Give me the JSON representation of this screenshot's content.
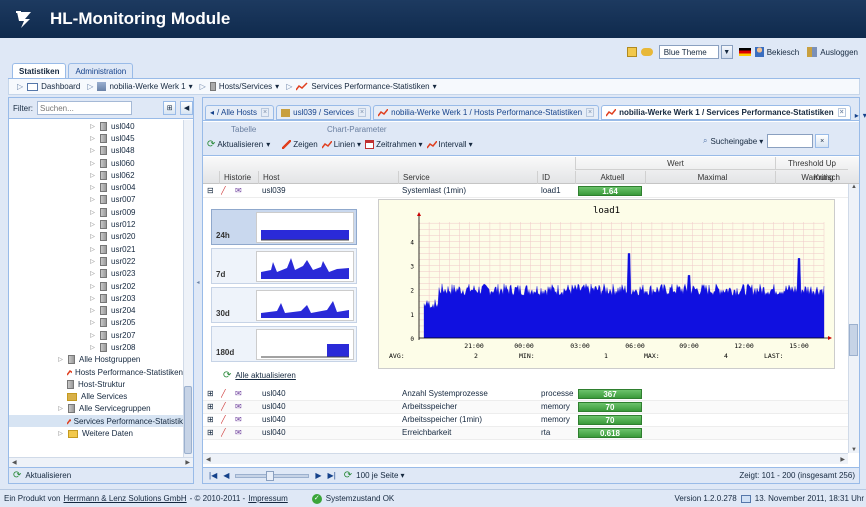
{
  "app": {
    "title": "HL-Monitoring Module"
  },
  "topbar": {
    "theme_value": "Blue Theme",
    "user_label": "Bekiesch",
    "logout_label": "Ausloggen"
  },
  "main_tabs": [
    {
      "label": "Statistiken",
      "active": true
    },
    {
      "label": "Administration",
      "active": false
    }
  ],
  "breadcrumb": [
    {
      "label": "Dashboard"
    },
    {
      "label": "nobilia-Werke Werk 1"
    },
    {
      "label": "Hosts/Services"
    },
    {
      "label": "Services Performance-Statistiken"
    }
  ],
  "left": {
    "filter_label": "Filter:",
    "filter_placeholder": "Suchen...",
    "tree": [
      {
        "label": "usl040",
        "type": "host"
      },
      {
        "label": "usl045",
        "type": "host"
      },
      {
        "label": "usl048",
        "type": "host"
      },
      {
        "label": "usl060",
        "type": "host"
      },
      {
        "label": "usl062",
        "type": "host"
      },
      {
        "label": "usr004",
        "type": "host"
      },
      {
        "label": "usr007",
        "type": "host"
      },
      {
        "label": "usr009",
        "type": "host"
      },
      {
        "label": "usr012",
        "type": "host"
      },
      {
        "label": "usr020",
        "type": "host"
      },
      {
        "label": "usr021",
        "type": "host"
      },
      {
        "label": "usr022",
        "type": "host"
      },
      {
        "label": "usr023",
        "type": "host"
      },
      {
        "label": "usr202",
        "type": "host"
      },
      {
        "label": "usr203",
        "type": "host"
      },
      {
        "label": "usr204",
        "type": "host"
      },
      {
        "label": "usr205",
        "type": "host"
      },
      {
        "label": "usr207",
        "type": "host"
      },
      {
        "label": "usr208",
        "type": "host"
      },
      {
        "label": "Alle Hostgruppen",
        "type": "group"
      },
      {
        "label": "Hosts Performance-Statistiken",
        "type": "perf"
      },
      {
        "label": "Host-Struktur",
        "type": "struct"
      },
      {
        "label": "Alle Services",
        "type": "services"
      },
      {
        "label": "Alle Servicegruppen",
        "type": "group"
      },
      {
        "label": "Services Performance-Statistik",
        "type": "perf"
      },
      {
        "label": "Weitere Daten",
        "type": "folder"
      }
    ],
    "refresh_label": "Aktualisieren"
  },
  "right_tabs": [
    {
      "label": "/ Alle Hosts"
    },
    {
      "label": "usl039 / Services"
    },
    {
      "label": "nobilia-Werke Werk 1 / Hosts Performance-Statistiken"
    },
    {
      "label": "nobilia-Werke Werk 1 / Services Performance-Statistiken"
    }
  ],
  "toolbar": {
    "group_table": "Tabelle",
    "group_chart": "Chart-Parameter",
    "refresh": "Aktualisieren",
    "show": "Zeigen",
    "lines": "Linien",
    "timeframe": "Zeitrahmen",
    "interval": "Intervall",
    "search_label": "Sucheingabe"
  },
  "grid": {
    "group_wert": "Wert",
    "group_threshold": "Threshold Up",
    "columns": [
      "Historie",
      "Host",
      "Service",
      "ID",
      "Aktuell",
      "Maximal",
      "Warnung",
      "Kritisch"
    ],
    "first_row": {
      "host": "usl039",
      "service": "Systemlast (1min)",
      "id": "load1",
      "aktuell": "1.64"
    },
    "rows": [
      {
        "host": "usl040",
        "service": "Anzahl Systemprozesse",
        "id": "processe",
        "aktuell": "367"
      },
      {
        "host": "usl040",
        "service": "Arbeitsspeicher",
        "id": "memory",
        "aktuell": "70"
      },
      {
        "host": "usl040",
        "service": "Arbeitsspeicher (1min)",
        "id": "memory",
        "aktuell": "70"
      },
      {
        "host": "usl040",
        "service": "Erreichbarkeit",
        "id": "rta",
        "aktuell": "0.618"
      }
    ]
  },
  "detail": {
    "thumbs": [
      "24h",
      "7d",
      "30d",
      "180d"
    ],
    "refresh_all": "Alle aktualisieren"
  },
  "chart_data": {
    "type": "area",
    "title": "load1",
    "y_ticks": [
      "0",
      "1",
      "2",
      "3",
      "4"
    ],
    "ylim": [
      0,
      4.8
    ],
    "x_ticks": [
      "21:00",
      "00:00",
      "03:00",
      "06:00",
      "09:00",
      "12:00",
      "15:00"
    ],
    "baseline": 2.0,
    "spikes": [
      {
        "x": "03:40",
        "value": 3.5
      },
      {
        "x": "06:00",
        "value": 2.6
      },
      {
        "x": "11:20",
        "value": 3.3
      }
    ],
    "stats": {
      "avg_label": "AVG:",
      "avg": "2",
      "min_label": "MIN:",
      "min": "1",
      "max_label": "MAX:",
      "max": "4",
      "last_label": "LAST:"
    },
    "color": "#1010e0"
  },
  "pager": {
    "per_page": "100 je Seite",
    "display": "Zeigt: 101 - 200 (insgesamt 256)"
  },
  "footer": {
    "product_prefix": "Ein Produkt von",
    "company": "Herrmann & Lenz Solutions GmbH",
    "copyright": "- © 2010-2011 -",
    "impressum": "Impressum",
    "status": "Systemzustand OK",
    "version": "Version 1.2.0.278",
    "date": "13. November 2011, 18:31 Uhr"
  }
}
